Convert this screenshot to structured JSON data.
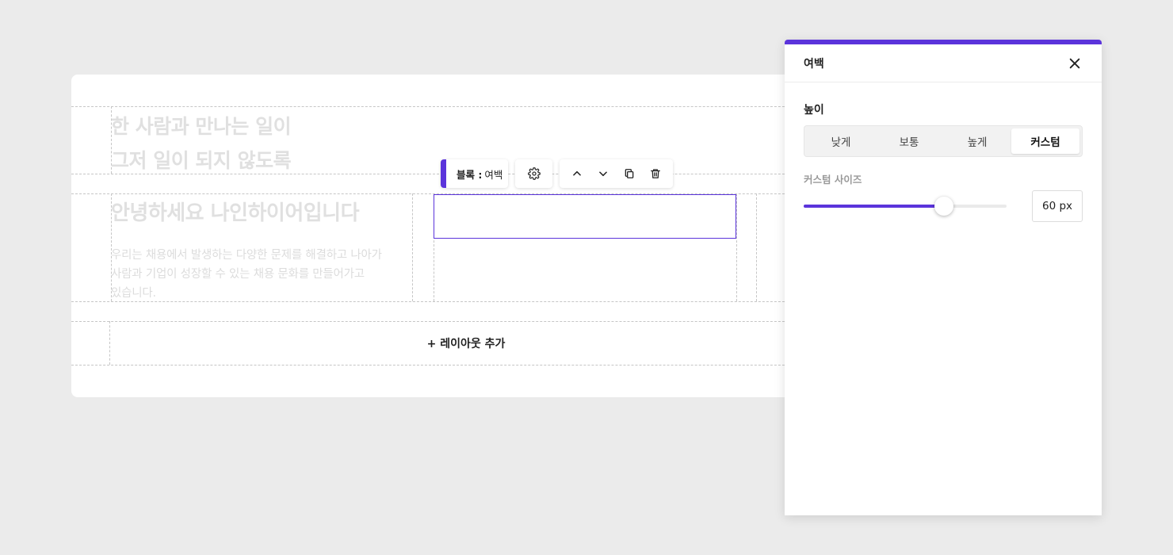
{
  "canvas": {
    "hero_lines": [
      "한 사람과 만나는 일이",
      "그저 일이 되지 않도록"
    ],
    "subtitle": "안녕하세요 나인하이어입니다",
    "body_lines": [
      "우리는 채용에서 발생하는 다양한 문제를 해결하고 나아가",
      "사람과 기업이 성장할 수 있는 채용 문화를 만들어가고",
      "있습니다."
    ],
    "add_layout_label": "+ 레이아웃 추가"
  },
  "block_toolbar": {
    "label_prefix": "블록 :",
    "label_value": "여백",
    "settings_icon": "gear-icon",
    "actions": [
      {
        "icon": "chevron-up-icon",
        "name": "move-up"
      },
      {
        "icon": "chevron-down-icon",
        "name": "move-down"
      },
      {
        "icon": "copy-icon",
        "name": "duplicate"
      },
      {
        "icon": "trash-icon",
        "name": "delete"
      }
    ]
  },
  "panel": {
    "title": "여백",
    "section_label": "높이",
    "options": [
      "낮게",
      "보통",
      "높게",
      "커스텀"
    ],
    "active_option": "커스텀",
    "custom_size_label": "커스텀 사이즈",
    "slider_fraction": 0.69,
    "size_value": "60 px"
  },
  "colors": {
    "accent": "#5b34db",
    "background": "#ebebeb",
    "placeholder_text": "#e0e0e0"
  }
}
